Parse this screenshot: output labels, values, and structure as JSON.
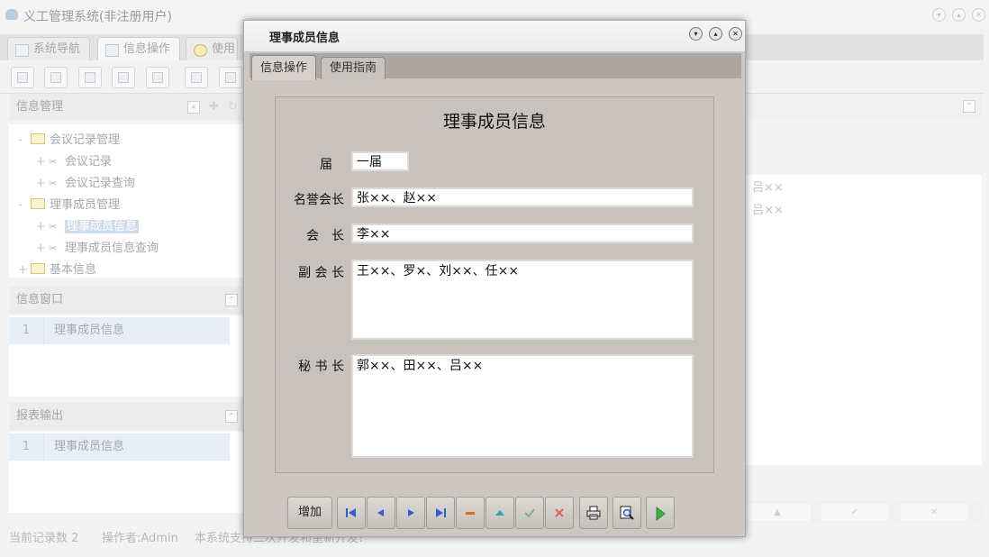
{
  "app": {
    "title": "义工管理系统(非注册用户)",
    "tabs": [
      {
        "label": "系统导航"
      },
      {
        "label": "信息操作"
      },
      {
        "label": "使用"
      }
    ],
    "left_panel": {
      "title": "信息管理",
      "tree": [
        {
          "label": "会议记录管理",
          "toggle": "-"
        },
        {
          "label": "会议记录",
          "toggle": "+"
        },
        {
          "label": "会议记录查询",
          "toggle": "+"
        },
        {
          "label": "理事成员管理",
          "toggle": "-"
        },
        {
          "label": "理事成员信息",
          "toggle": "+"
        },
        {
          "label": "理事成员信息查询",
          "toggle": "+"
        },
        {
          "label": "基本信息",
          "toggle": "+"
        }
      ]
    },
    "info_window": {
      "title": "信息窗口",
      "rows": [
        {
          "num": "1",
          "label": "理事成员信息"
        }
      ]
    },
    "report_output": {
      "title": "报表输出",
      "rows": [
        {
          "num": "1",
          "label": "理事成员信息"
        }
      ]
    },
    "right_fragments": [
      "、吕××",
      "、吕××"
    ],
    "status": {
      "record_count": "当前记录数 2",
      "operator": "操作者:Admin",
      "note": "本系统支持二次开发和重新开发!"
    }
  },
  "dialog": {
    "title": "理事成员信息",
    "tabs": [
      {
        "label": "信息操作",
        "active": true
      },
      {
        "label": "使用指南",
        "active": false
      }
    ],
    "form": {
      "heading": "理事成员信息",
      "fields": {
        "session": {
          "label": "届",
          "value": "一届"
        },
        "honorary_president": {
          "label": "名誉会长",
          "value": "张××、赵××"
        },
        "president": {
          "label": "会　长",
          "value": "李××"
        },
        "vice_president": {
          "label": "副 会 长",
          "value": "王××、罗×、刘××、任××"
        },
        "secretary_general": {
          "label": "秘 书 长",
          "value": "郭××、田××、吕××"
        }
      }
    },
    "buttons": {
      "add": "增加"
    },
    "colors": {
      "nav_blue": "#2f5fd0",
      "delete_orange": "#e06a1a",
      "confirm_green": "#7fb07a",
      "cancel_red": "#e06060",
      "run_green": "#3cb43c"
    }
  }
}
